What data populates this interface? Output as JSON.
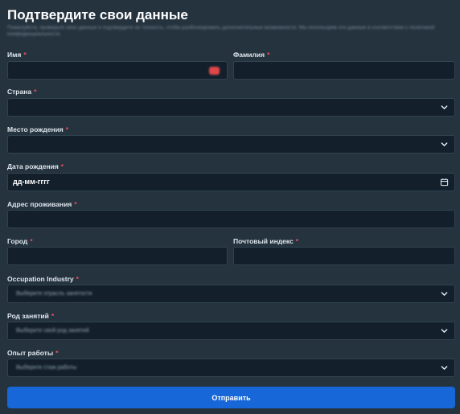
{
  "form": {
    "title": "Подтвердите свои данные",
    "subtitle": "Пожалуйста, проверьте свои данные и подтвердите их точность, чтобы разблокировать дополнительные возможности. Мы используем эти данные в соответствии с политикой конфиденциальности.",
    "required_mark": "*",
    "first_name": {
      "label": "Имя",
      "value": ""
    },
    "last_name": {
      "label": "Фамилия",
      "value": ""
    },
    "country": {
      "label": "Страна",
      "selected": ""
    },
    "birthplace": {
      "label": "Место рождения",
      "selected": ""
    },
    "birthdate": {
      "label": "Дата рождения",
      "value": "дд-мм-гггг"
    },
    "address": {
      "label": "Адрес проживания",
      "value": ""
    },
    "city": {
      "label": "Город",
      "value": ""
    },
    "postal_code": {
      "label": "Почтовый индекс",
      "value": ""
    },
    "occupation_industry": {
      "label": "Occupation Industry",
      "placeholder": "Выберите отрасль занятости"
    },
    "occupation": {
      "label": "Род занятий",
      "placeholder": "Выберите свой род занятий"
    },
    "experience": {
      "label": "Опыт работы",
      "placeholder": "Выберите стаж работы"
    },
    "submit_label": "Отправить"
  },
  "icons": {
    "select": "chevron-down-icon",
    "date": "calendar-icon",
    "autofill": "autofill-icon"
  },
  "colors": {
    "background": "#25333f",
    "input_background": "#13202c",
    "required": "#ef4d59",
    "accent": "#1767d8"
  }
}
